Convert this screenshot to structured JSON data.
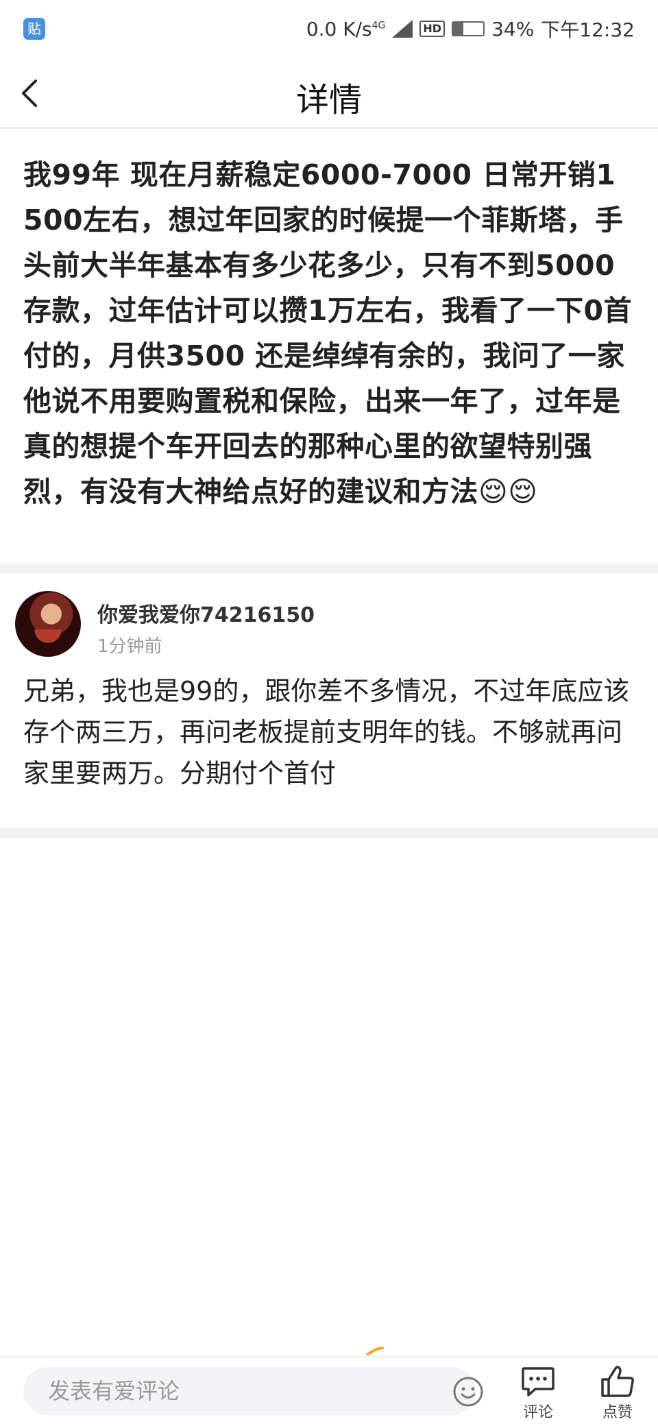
{
  "status_bar": {
    "app_badge": "贴",
    "net_speed": "0.0 K/s",
    "network_type": "4G",
    "hd": "HD",
    "battery_percent": "34%",
    "battery_level": 0.34,
    "time": "下午12:32"
  },
  "nav": {
    "title": "详情",
    "back_icon": "chevron-left-icon"
  },
  "post": {
    "text": "我99年 现在月薪稳定6000-7000 日常开销1500左右，想过年回家的时候提一个菲斯塔，手头前大半年基本有多少花多少，只有不到5000存款，过年估计可以攒1万左右，我看了一下0首付的，月供3500 还是绰绰有余的，我问了一家他说不用要购置税和保险，出来一年了，过年是真的想提个车开回去的那种心里的欲望特别强烈，有没有大神给点好的建议和方法😌😌"
  },
  "comment": {
    "username": "你爱我爱你74216150",
    "time": "1分钟前",
    "text": "兄弟，我也是99的，跟你差不多情况，不过年底应该存个两三万，再问老板提前支明年的钱。不够就再问家里要两万。分期付个首付"
  },
  "bottom_bar": {
    "input_placeholder": "发表有爱评论",
    "comment_label": "评论",
    "like_label": "点赞",
    "accent_color": "#f5a623"
  }
}
